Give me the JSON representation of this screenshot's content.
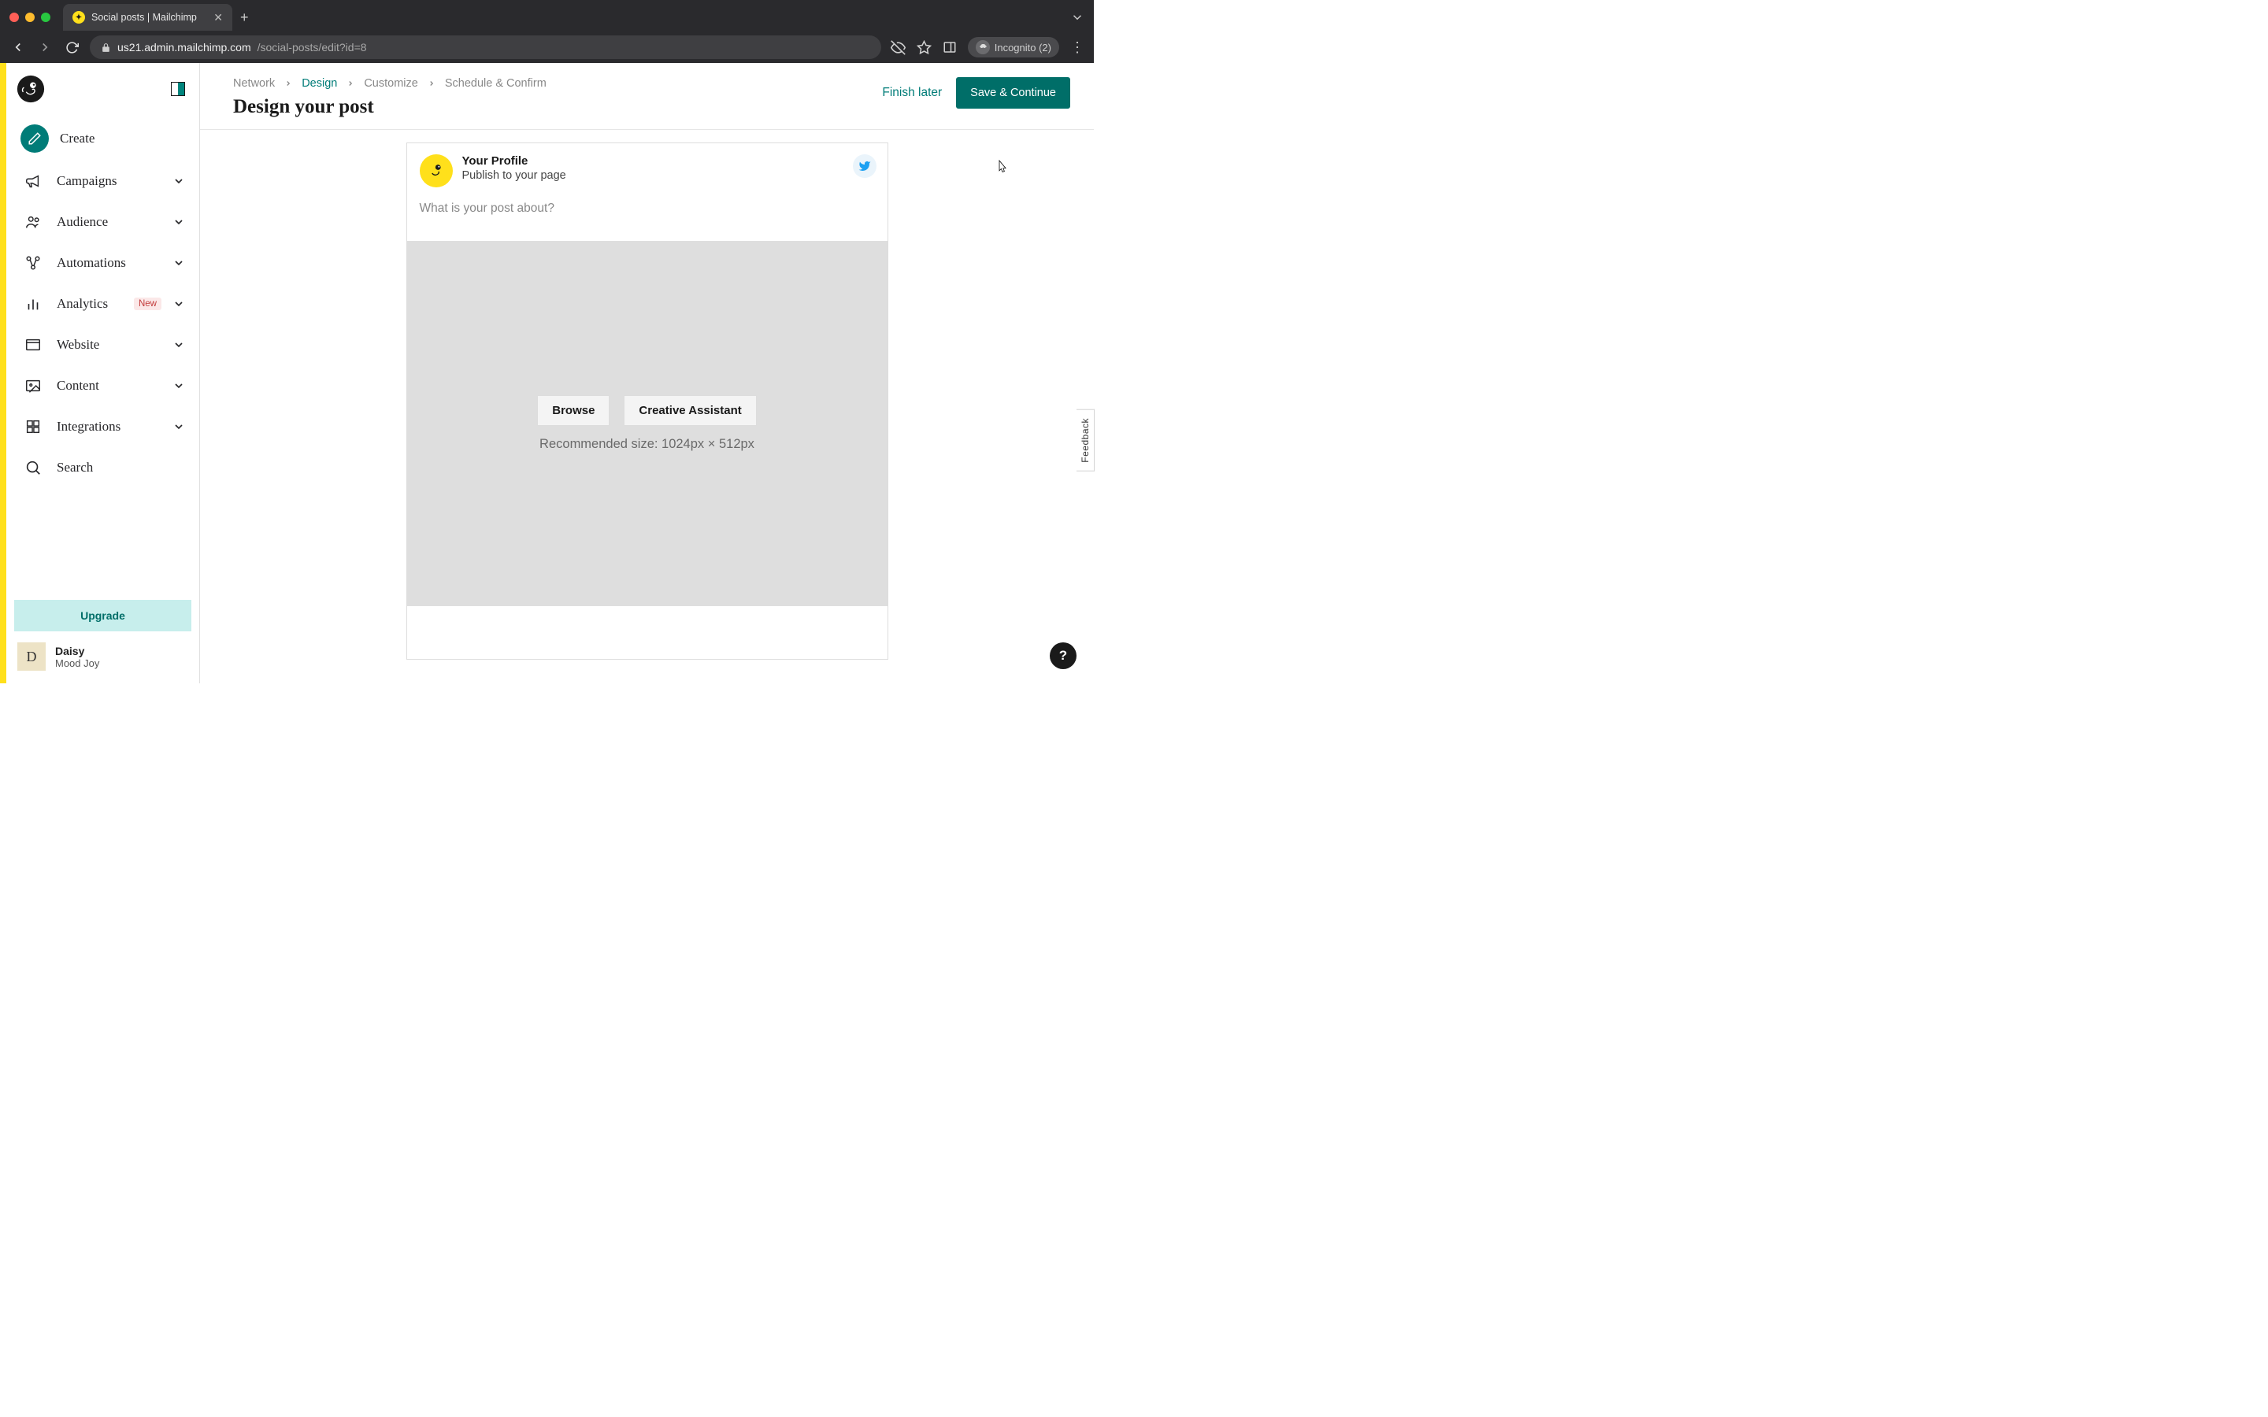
{
  "browser": {
    "tab_title": "Social posts | Mailchimp",
    "url_host": "us21.admin.mailchimp.com",
    "url_path": "/social-posts/edit?id=8",
    "incognito_label": "Incognito (2)"
  },
  "sidebar": {
    "items": [
      {
        "label": "Create",
        "icon": "pencil",
        "expandable": false,
        "create": true
      },
      {
        "label": "Campaigns",
        "icon": "megaphone",
        "expandable": true
      },
      {
        "label": "Audience",
        "icon": "people",
        "expandable": true
      },
      {
        "label": "Automations",
        "icon": "flow",
        "expandable": true
      },
      {
        "label": "Analytics",
        "icon": "bars",
        "expandable": true,
        "badge": "New"
      },
      {
        "label": "Website",
        "icon": "window",
        "expandable": true
      },
      {
        "label": "Content",
        "icon": "image",
        "expandable": true
      },
      {
        "label": "Integrations",
        "icon": "grid",
        "expandable": true
      },
      {
        "label": "Search",
        "icon": "search",
        "expandable": false
      }
    ],
    "upgrade_label": "Upgrade",
    "user": {
      "initial": "D",
      "name": "Daisy",
      "sub": "Mood Joy"
    }
  },
  "header": {
    "breadcrumbs": [
      {
        "label": "Network",
        "active": false
      },
      {
        "label": "Design",
        "active": true
      },
      {
        "label": "Customize",
        "active": false
      },
      {
        "label": "Schedule & Confirm",
        "active": false
      }
    ],
    "page_title": "Design your post",
    "finish_later": "Finish later",
    "save_continue": "Save & Continue"
  },
  "post": {
    "profile_name": "Your Profile",
    "profile_sub": "Publish to your page",
    "placeholder": "What is your post about?",
    "browse_label": "Browse",
    "creative_label": "Creative Assistant",
    "size_hint": "Recommended size: 1024px × 512px"
  },
  "feedback_label": "Feedback",
  "help_label": "?"
}
